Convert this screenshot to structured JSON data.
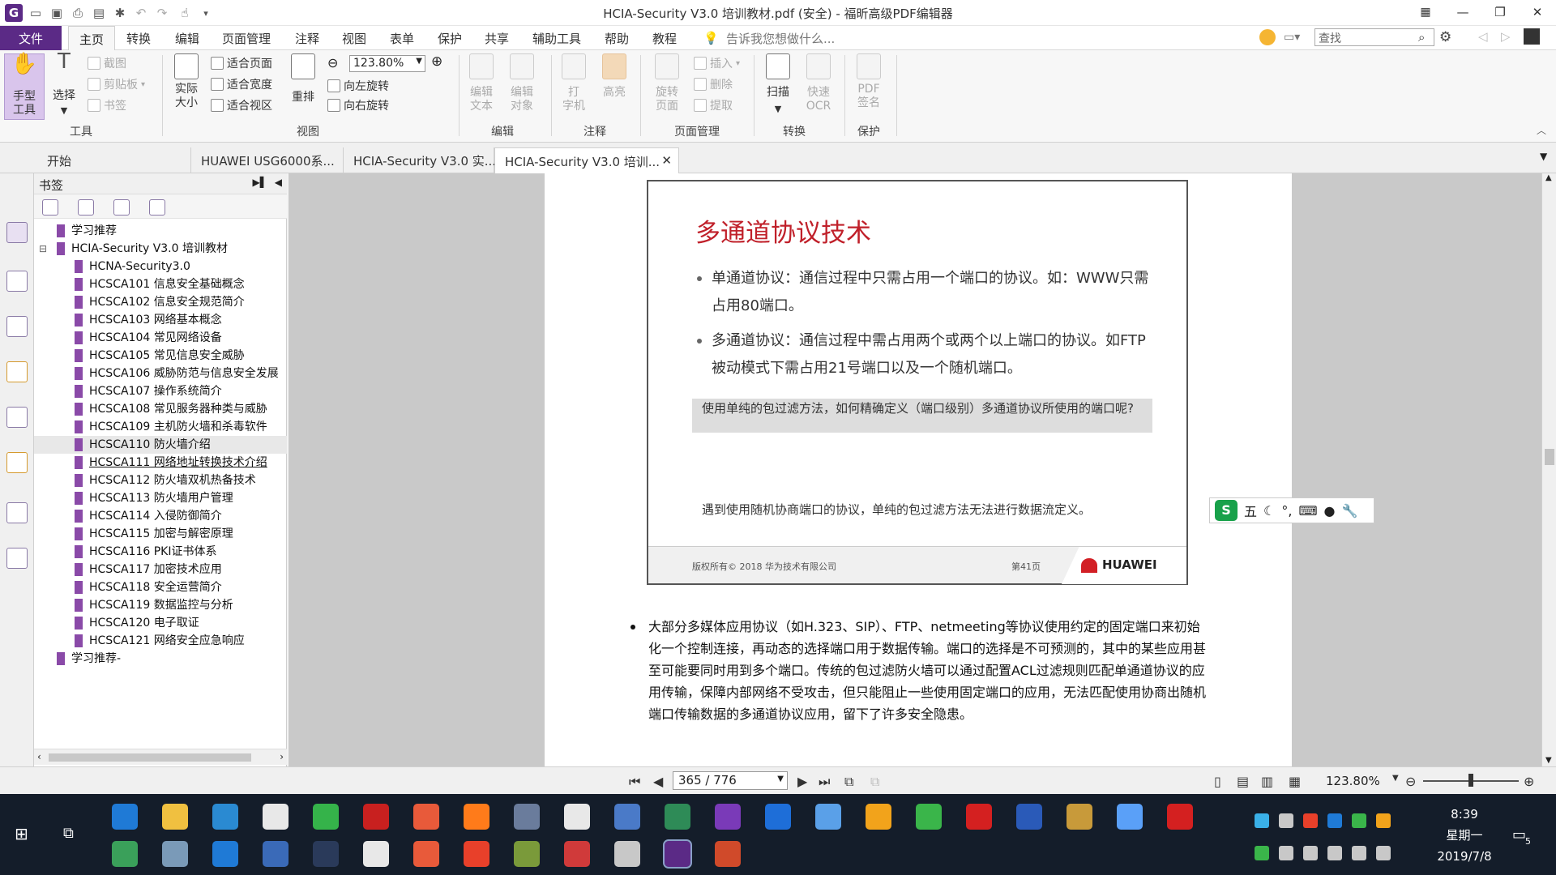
{
  "window": {
    "title": "HCIA-Security V3.0 培训教材.pdf (安全) - 福昕高级PDF编辑器"
  },
  "menu": {
    "file": "文件",
    "tabs": [
      "主页",
      "转换",
      "编辑",
      "页面管理",
      "注释",
      "视图",
      "表单",
      "保护",
      "共享",
      "辅助工具",
      "帮助",
      "教程"
    ],
    "tell_me": "告诉我您想做什么...",
    "search_placeholder": "查找"
  },
  "ribbon": {
    "tools": {
      "hand": "手型\n工具",
      "select": "选择",
      "screenshot": "截图",
      "clipboard": "剪贴板",
      "bookmark": "书签",
      "label": "工具"
    },
    "view": {
      "actual_size": "实际\n大小",
      "fit_page": "适合页面",
      "fit_width": "适合宽度",
      "fit_view": "适合视区",
      "reflow": "重排",
      "rotate_left": "向左旋转",
      "rotate_right": "向右旋转",
      "zoom": "123.80%",
      "label": "视图"
    },
    "edit": {
      "edit_text": "编辑\n文本",
      "edit_object": "编辑\n对象",
      "label": "编辑"
    },
    "comment": {
      "typewriter": "打\n字机",
      "highlight": "高亮",
      "label": "注释"
    },
    "pages": {
      "rotate": "旋转\n页面",
      "insert": "插入",
      "delete": "删除",
      "extract": "提取",
      "label": "页面管理"
    },
    "convert": {
      "scan": "扫描",
      "ocr": "快速\nOCR",
      "label": "转换"
    },
    "protect": {
      "pdf_sign": "PDF\n签名",
      "label": "保护"
    }
  },
  "doc_tabs": [
    "开始",
    "HUAWEI USG6000系...",
    "HCIA-Security V3.0 实...",
    "HCIA-Security V3.0 培训..."
  ],
  "bookmarks": {
    "title": "书签",
    "items": [
      {
        "label": "学习推荐",
        "level": 0
      },
      {
        "label": "HCIA-Security V3.0 培训教材",
        "level": 0
      },
      {
        "label": "HCNA-Security3.0",
        "level": 1
      },
      {
        "label": "HCSCA101 信息安全基础概念",
        "level": 1
      },
      {
        "label": "HCSCA102 信息安全规范简介",
        "level": 1
      },
      {
        "label": "HCSCA103 网络基本概念",
        "level": 1
      },
      {
        "label": "HCSCA104 常见网络设备",
        "level": 1
      },
      {
        "label": "HCSCA105 常见信息安全威胁",
        "level": 1
      },
      {
        "label": "HCSCA106 威胁防范与信息安全发展",
        "level": 1
      },
      {
        "label": "HCSCA107 操作系统简介",
        "level": 1
      },
      {
        "label": "HCSCA108 常见服务器种类与威胁",
        "level": 1
      },
      {
        "label": "HCSCA109 主机防火墙和杀毒软件",
        "level": 1
      },
      {
        "label": "HCSCA110 防火墙介绍",
        "level": 1
      },
      {
        "label": "HCSCA111 网络地址转换技术介绍",
        "level": 1
      },
      {
        "label": "HCSCA112 防火墙双机热备技术",
        "level": 1
      },
      {
        "label": "HCSCA113 防火墙用户管理",
        "level": 1
      },
      {
        "label": "HCSCA114 入侵防御简介",
        "level": 1
      },
      {
        "label": "HCSCA115 加密与解密原理",
        "level": 1
      },
      {
        "label": "HCSCA116 PKI证书体系",
        "level": 1
      },
      {
        "label": "HCSCA117 加密技术应用",
        "level": 1
      },
      {
        "label": "HCSCA118 安全运营简介",
        "level": 1
      },
      {
        "label": "HCSCA119 数据监控与分析",
        "level": 1
      },
      {
        "label": "HCSCA120 电子取证",
        "level": 1
      },
      {
        "label": "HCSCA121 网络安全应急响应",
        "level": 1
      },
      {
        "label": "学习推荐-",
        "level": 0
      }
    ]
  },
  "slide": {
    "title": "多通道协议技术",
    "bullet1": "单通道协议：通信过程中只需占用一个端口的协议。如：WWW只需占用80端口。",
    "bullet2": "多通道协议：通信过程中需占用两个或两个以上端口的协议。如FTP被动模式下需占用21号端口以及一个随机端口。",
    "question": "使用单纯的包过滤方法，如何精确定义（端口级别）多通道协议所使用的端口呢?",
    "note": "遇到使用随机协商端口的协议，单纯的包过滤方法无法进行数据流定义。",
    "copyright": "版权所有© 2018 华为技术有限公司",
    "page_label": "第41页",
    "logo": "HUAWEI"
  },
  "body_text": "大部分多媒体应用协议（如H.323、SIP）、FTP、netmeeting等协议使用约定的固定端口来初始化一个控制连接，再动态的选择端口用于数据传输。端口的选择是不可预测的，其中的某些应用甚至可能要同时用到多个端口。传统的包过滤防火墙可以通过配置ACL过滤规则匹配单通道协议的应用传输，保障内部网络不受攻击，但只能阻止一些使用固定端口的应用，无法匹配使用协商出随机端口传输数据的多通道协议应用，留下了许多安全隐患。",
  "ime": {
    "mode": "五"
  },
  "status": {
    "page": "365 / 776",
    "zoom": "123.80%"
  },
  "clock": {
    "time": "8:39",
    "weekday": "星期一",
    "date": "2019/7/8"
  },
  "notification_count": "5"
}
